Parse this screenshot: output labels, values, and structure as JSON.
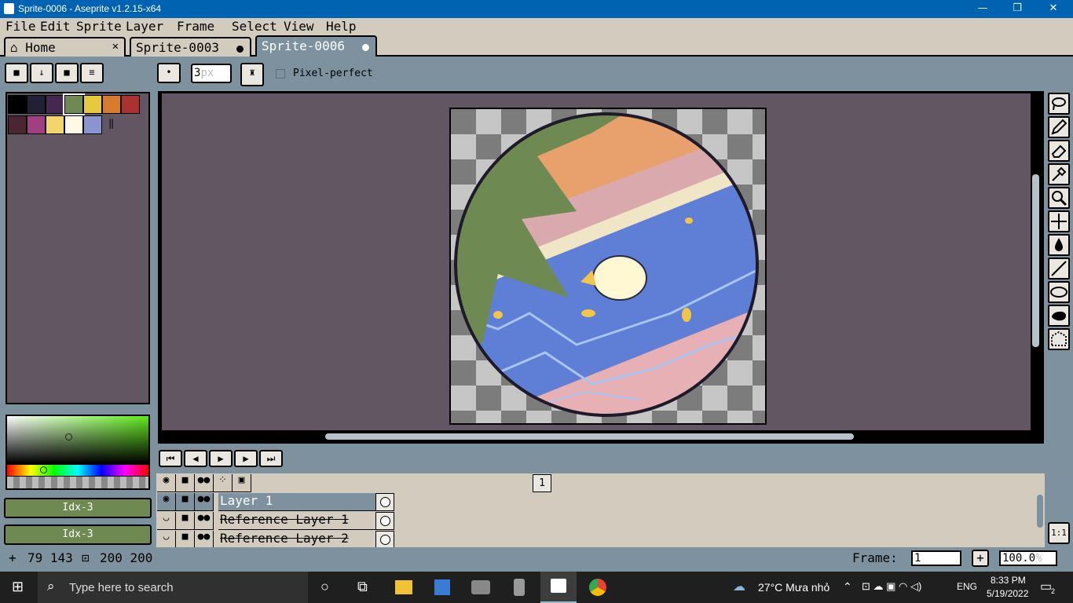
{
  "window": {
    "title": "Sprite-0006 - Aseprite v1.2.15-x64",
    "minimize": "—",
    "restore": "❐",
    "close": "✕"
  },
  "menu": [
    "File",
    "Edit",
    "Sprite",
    "Layer",
    "Frame",
    "Select",
    "View",
    "Help"
  ],
  "tabs": [
    {
      "label": "Home",
      "close": "✕"
    },
    {
      "label": "Sprite-0003"
    },
    {
      "label": "Sprite-0006"
    }
  ],
  "toolbar": {
    "brush_size": "3",
    "brush_unit": "px",
    "pixel_perfect_label": "Pixel-perfect"
  },
  "palette": {
    "colors": [
      "#000000",
      "#222034",
      "#45284f",
      "#6e8a52",
      "#e6c93c",
      "#d77b2c",
      "#ac3232",
      "#4a2532",
      "#a13f83",
      "#f2d66b",
      "#fff8e6",
      "#8a94cf"
    ],
    "selected_index": 3,
    "more_indicator": "‖"
  },
  "color_picker": {
    "hue_color": "#5fe81a"
  },
  "fg_color": {
    "label": "Idx-3",
    "color": "#6e8a52"
  },
  "bg_color": {
    "label": "Idx-3",
    "color": "#6e8a52"
  },
  "canvas": {
    "bg_color": "#625663"
  },
  "timeline": {
    "frame_header": "1",
    "layers": [
      {
        "name": "Layer 1",
        "active": true,
        "visible": true,
        "strike": false
      },
      {
        "name": "Reference Layer 1",
        "active": false,
        "visible": false,
        "strike": true
      },
      {
        "name": "Reference Layer 2",
        "active": false,
        "visible": false,
        "strike": true
      }
    ]
  },
  "status": {
    "cursor_pos": "79 143",
    "sprite_size": "200 200",
    "frame_label": "Frame:",
    "frame_value": "1",
    "zoom_value": "100.0",
    "zoom_unit": "%",
    "onetoone": "1:1"
  },
  "taskbar": {
    "search_placeholder": "Type here to search",
    "weather": "27°C  Mưa nhỏ",
    "lang": "ENG",
    "time": "8:33 PM",
    "date": "5/19/2022",
    "notif_count": "2"
  }
}
